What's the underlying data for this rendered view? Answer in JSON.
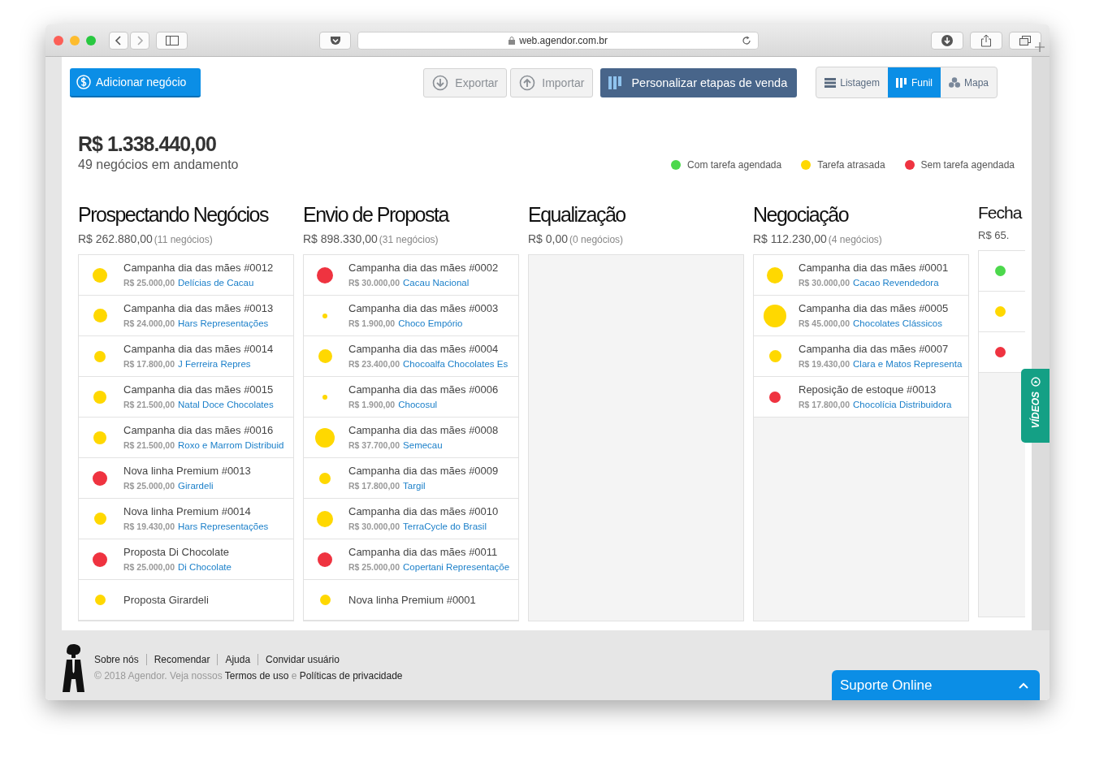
{
  "browser": {
    "url": "web.agendor.com.br"
  },
  "toolbar": {
    "add_button": "Adicionar negócio",
    "export_button": "Exportar",
    "import_button": "Importar",
    "customize_button": "Personalizar etapas de venda",
    "views": [
      {
        "label": "Listagem",
        "kind": "list",
        "selected": false
      },
      {
        "label": "Funil",
        "kind": "funnel",
        "selected": true
      },
      {
        "label": "Mapa",
        "kind": "map",
        "selected": false
      }
    ]
  },
  "summary": {
    "total": "R$ 1.338.440,00",
    "subtitle": "49 negócios em andamento"
  },
  "legend": [
    {
      "label": "Com tarefa agendada",
      "color": "#4cd84c"
    },
    {
      "label": "Tarefa atrasada",
      "color": "#ffd800"
    },
    {
      "label": "Sem tarefa agendada",
      "color": "#ef3340"
    }
  ],
  "stages": [
    {
      "name": "Prospectando Negócios",
      "total": "R$ 262.880,00",
      "count": "(11 negócios)",
      "deals": [
        {
          "title": "Campanha dia das mães #0012",
          "value": "R$ 25.000,00",
          "company": "Delícias de Cacau",
          "color": "#ffd800"
        },
        {
          "title": "Campanha dia das mães #0013",
          "value": "R$ 24.000,00",
          "company": "Hars Representações",
          "color": "#ffd800"
        },
        {
          "title": "Campanha dia das mães #0014",
          "value": "R$ 17.800,00",
          "company": "J Ferreira Repres",
          "color": "#ffd800"
        },
        {
          "title": "Campanha dia das mães #0015",
          "value": "R$ 21.500,00",
          "company": "Natal Doce Chocolates",
          "color": "#ffd800"
        },
        {
          "title": "Campanha dia das mães #0016",
          "value": "R$ 21.500,00",
          "company": "Roxo e Marrom Distribuid",
          "color": "#ffd800"
        },
        {
          "title": "Nova linha Premium #0013",
          "value": "R$ 25.000,00",
          "company": "Girardeli",
          "color": "#ef3340"
        },
        {
          "title": "Nova linha Premium #0014",
          "value": "R$ 19.430,00",
          "company": "Hars Representações",
          "color": "#ffd800"
        },
        {
          "title": "Proposta Di Chocolate",
          "value": "R$ 25.000,00",
          "company": "Di Chocolate",
          "color": "#ef3340"
        },
        {
          "title": "Proposta Girardeli",
          "color": "#ffd800"
        }
      ]
    },
    {
      "name": "Envio de Proposta",
      "total": "R$ 898.330,00",
      "count": "(31 negócios)",
      "deals": [
        {
          "title": "Campanha dia das mães #0002",
          "value": "R$ 30.000,00",
          "company": "Cacau Nacional",
          "color": "#ef3340"
        },
        {
          "title": "Campanha dia das mães #0003",
          "value": "R$ 1.900,00",
          "company": "Choco Empório",
          "color": "#ffd800"
        },
        {
          "title": "Campanha dia das mães #0004",
          "value": "R$ 23.400,00",
          "company": "Chocoalfa Chocolates Es",
          "color": "#ffd800"
        },
        {
          "title": "Campanha dia das mães #0006",
          "value": "R$ 1.900,00",
          "company": "Chocosul",
          "color": "#ffd800"
        },
        {
          "title": "Campanha dia das mães #0008",
          "value": "R$ 37.700,00",
          "company": "Semecau",
          "color": "#ffd800"
        },
        {
          "title": "Campanha dia das mães #0009",
          "value": "R$ 17.800,00",
          "company": "Targil",
          "color": "#ffd800"
        },
        {
          "title": "Campanha dia das mães #0010",
          "value": "R$ 30.000,00",
          "company": "TerraCycle do Brasil",
          "color": "#ffd800"
        },
        {
          "title": "Campanha dia das mães #0011",
          "value": "R$ 25.000,00",
          "company": "Copertani Representaçõe",
          "color": "#ef3340"
        },
        {
          "title": "Nova linha Premium #0001",
          "color": "#ffd800"
        }
      ]
    },
    {
      "name": "Equalização",
      "total": "R$ 0,00",
      "count": "(0 negócios)"
    },
    {
      "name": "Negociação",
      "total": "R$ 112.230,00",
      "count": "(4 negócios)",
      "deals": [
        {
          "title": "Campanha dia das mães #0001",
          "value": "R$ 30.000,00",
          "company": "Cacao Revendedora",
          "color": "#ffd800"
        },
        {
          "title": "Campanha dia das mães #0005",
          "value": "R$ 45.000,00",
          "company": "Chocolates Clássicos",
          "color": "#ffd800"
        },
        {
          "title": "Campanha dia das mães #0007",
          "value": "R$ 19.430,00",
          "company": "Clara e Matos Representa",
          "color": "#ffd800"
        },
        {
          "title": "Reposição de estoque #0013",
          "value": "R$ 17.800,00",
          "company": "Chocolícia Distribuidora",
          "color": "#ef3340"
        }
      ]
    },
    {
      "name": "Fecha",
      "total": "R$ 65.",
      "deals": [
        {
          "color": "#4cd84c"
        },
        {
          "color": "#ffd800"
        },
        {
          "color": "#ef3340"
        }
      ]
    }
  ],
  "videos_tab": "VÍDEOS",
  "footer": {
    "links": [
      "Sobre nós",
      "Recomendar",
      "Ajuda",
      "Convidar usuário"
    ],
    "copyright": "© 2018 Agendor. Veja nossos",
    "terms": "Termos de uso",
    "conjunction": "e",
    "privacy": "Políticas de privacidade"
  },
  "chat": {
    "label": "Suporte Online"
  }
}
